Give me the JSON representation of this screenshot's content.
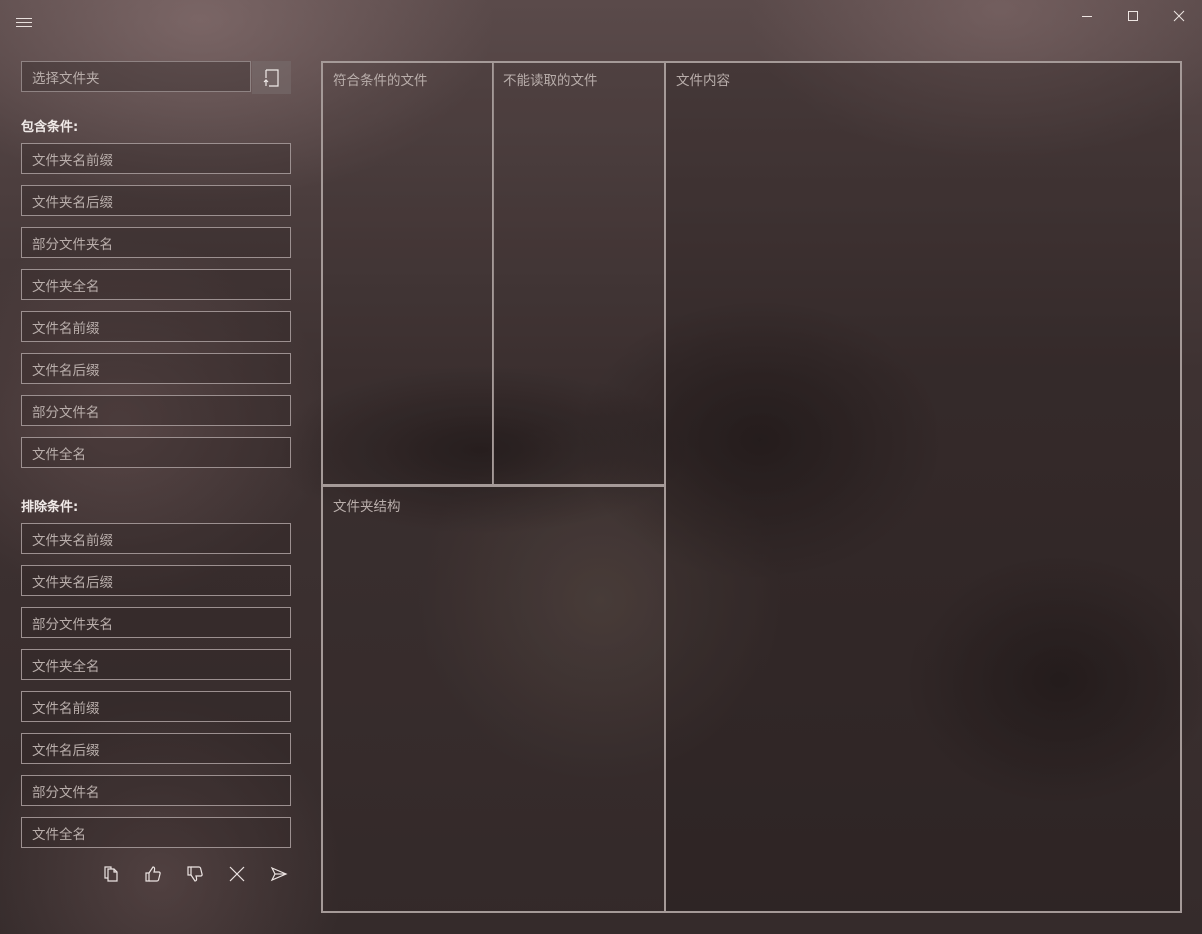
{
  "titlebar": {
    "menu_icon": "hamburger-icon",
    "minimize_icon": "minimize-icon",
    "maximize_icon": "maximize-icon",
    "close_icon": "close-icon"
  },
  "folder_picker": {
    "placeholder": "选择文件夹",
    "button_icon": "folder-open-icon"
  },
  "include": {
    "label": "包含条件:",
    "fields": [
      "文件夹名前缀",
      "文件夹名后缀",
      "部分文件夹名",
      "文件夹全名",
      "文件名前缀",
      "文件名后缀",
      "部分文件名",
      "文件全名"
    ]
  },
  "exclude": {
    "label": "排除条件:",
    "fields": [
      "文件夹名前缀",
      "文件夹名后缀",
      "部分文件夹名",
      "文件夹全名",
      "文件名前缀",
      "文件名后缀",
      "部分文件名",
      "文件全名"
    ]
  },
  "actions": [
    "copy-icon",
    "thumbs-up-icon",
    "thumbs-down-icon",
    "clear-icon",
    "send-icon"
  ],
  "panes": {
    "matched": "符合条件的文件",
    "unreadable": "不能读取的文件",
    "structure": "文件夹结构",
    "content": "文件内容"
  }
}
